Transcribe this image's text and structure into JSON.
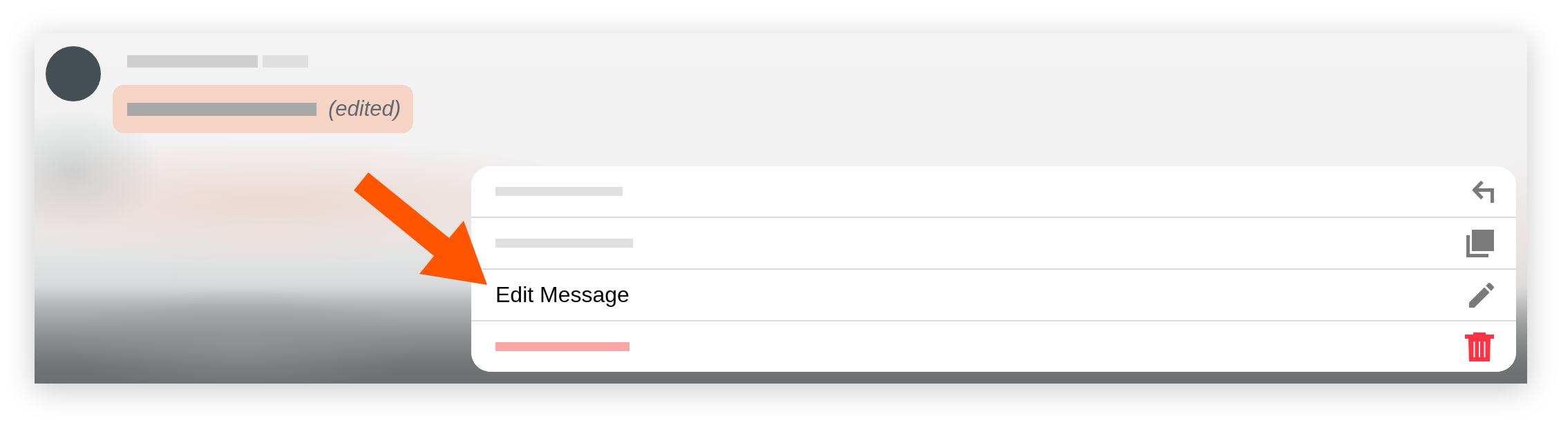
{
  "message": {
    "edited_label": "(edited)"
  },
  "menu": {
    "items": [
      {
        "kind": "redacted",
        "destructive": false
      },
      {
        "kind": "redacted",
        "destructive": false
      },
      {
        "kind": "text",
        "label": "Edit Message",
        "destructive": false
      },
      {
        "kind": "redacted",
        "destructive": true
      }
    ]
  }
}
